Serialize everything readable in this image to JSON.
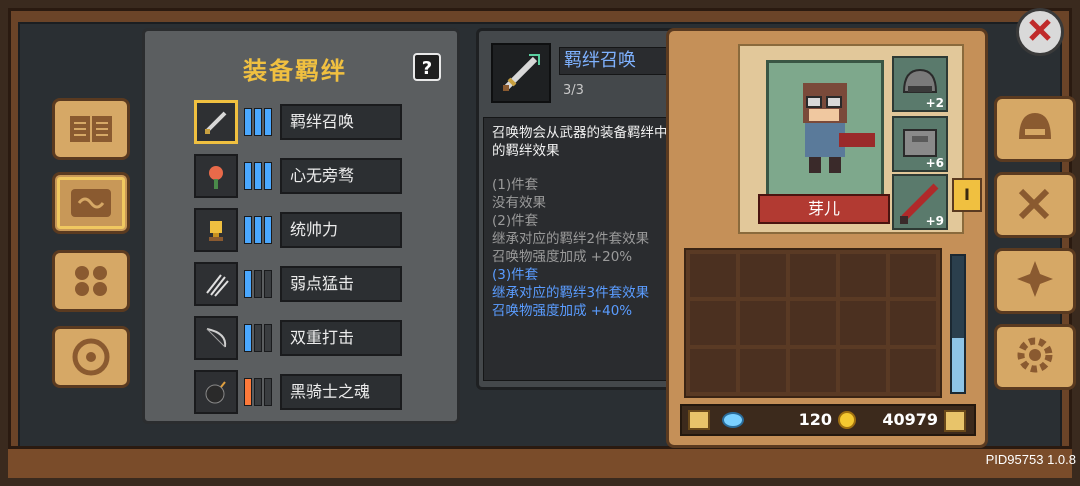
{
  "set_panel": {
    "title": "装备羁绊",
    "help_label": "?",
    "bonds": [
      {
        "name": "羁绊召唤",
        "active_bars": 3,
        "bar_color": "#4aa8ff",
        "icon": "sword-icon",
        "selected": true
      },
      {
        "name": "心无旁骛",
        "active_bars": 3,
        "bar_color": "#4aa8ff",
        "icon": "flower-icon",
        "selected": false
      },
      {
        "name": "统帅力",
        "active_bars": 3,
        "bar_color": "#4aa8ff",
        "icon": "trophy-icon",
        "selected": false
      },
      {
        "name": "弱点猛击",
        "active_bars": 1,
        "bar_color": "#4aa8ff",
        "icon": "claw-icon",
        "selected": false
      },
      {
        "name": "双重打击",
        "active_bars": 1,
        "bar_color": "#4aa8ff",
        "icon": "bow-icon",
        "selected": false
      },
      {
        "name": "黑骑士之魂",
        "active_bars": 1,
        "bar_color": "#ff7a3a",
        "icon": "bomb-icon",
        "selected": false
      }
    ]
  },
  "tooltip": {
    "name": "羁绊召唤",
    "count": "3/3",
    "description": "召唤物会从武器的装备羁绊中继承对应的羁绊效果",
    "tiers": [
      {
        "lines": [
          "(1)件套",
          "没有效果"
        ],
        "active": false
      },
      {
        "lines": [
          "(2)件套",
          "继承对应的羁绊2件套效果",
          "召唤物强度加成 +20%"
        ],
        "active": false
      },
      {
        "lines": [
          "(3)件套",
          "继承对应的羁绊3件套效果",
          "召唤物强度加成 +40%"
        ],
        "active": true
      }
    ]
  },
  "character": {
    "name": "芽儿",
    "equip": [
      {
        "icon": "helmet-icon",
        "plus": "+2"
      },
      {
        "icon": "armor-icon",
        "plus": "+6"
      },
      {
        "icon": "sword-icon",
        "plus": "+9"
      }
    ],
    "level_tag": "I",
    "inventory_scroll_fraction": 0.4
  },
  "currency": {
    "gems": "120",
    "coins": "40979"
  },
  "version": "PID95753 1.0.8",
  "colors": {
    "title_gold": "#f0c040",
    "tooltip_name": "#7fb2ff",
    "tier_active": "#5a9cff",
    "tier_inactive": "#9a9a9a"
  }
}
